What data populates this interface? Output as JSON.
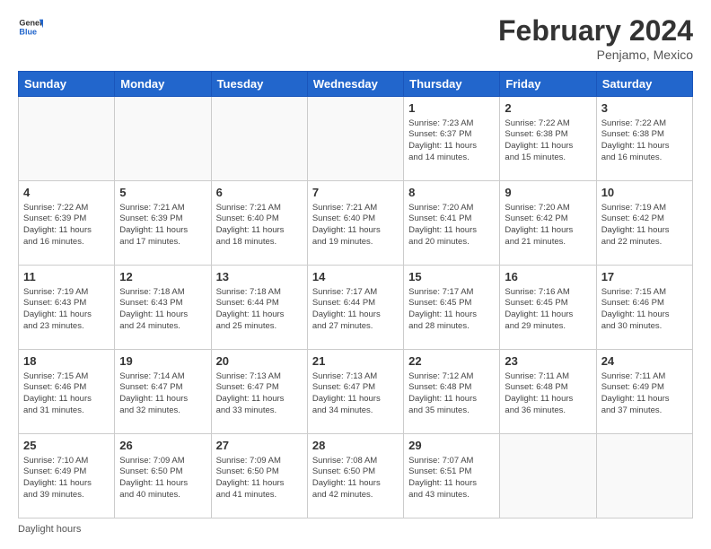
{
  "header": {
    "logo_line1": "General",
    "logo_line2": "Blue",
    "title": "February 2024",
    "subtitle": "Penjamo, Mexico"
  },
  "days_of_week": [
    "Sunday",
    "Monday",
    "Tuesday",
    "Wednesday",
    "Thursday",
    "Friday",
    "Saturday"
  ],
  "weeks": [
    [
      {
        "day": "",
        "info": ""
      },
      {
        "day": "",
        "info": ""
      },
      {
        "day": "",
        "info": ""
      },
      {
        "day": "",
        "info": ""
      },
      {
        "day": "1",
        "info": "Sunrise: 7:23 AM\nSunset: 6:37 PM\nDaylight: 11 hours\nand 14 minutes."
      },
      {
        "day": "2",
        "info": "Sunrise: 7:22 AM\nSunset: 6:38 PM\nDaylight: 11 hours\nand 15 minutes."
      },
      {
        "day": "3",
        "info": "Sunrise: 7:22 AM\nSunset: 6:38 PM\nDaylight: 11 hours\nand 16 minutes."
      }
    ],
    [
      {
        "day": "4",
        "info": "Sunrise: 7:22 AM\nSunset: 6:39 PM\nDaylight: 11 hours\nand 16 minutes."
      },
      {
        "day": "5",
        "info": "Sunrise: 7:21 AM\nSunset: 6:39 PM\nDaylight: 11 hours\nand 17 minutes."
      },
      {
        "day": "6",
        "info": "Sunrise: 7:21 AM\nSunset: 6:40 PM\nDaylight: 11 hours\nand 18 minutes."
      },
      {
        "day": "7",
        "info": "Sunrise: 7:21 AM\nSunset: 6:40 PM\nDaylight: 11 hours\nand 19 minutes."
      },
      {
        "day": "8",
        "info": "Sunrise: 7:20 AM\nSunset: 6:41 PM\nDaylight: 11 hours\nand 20 minutes."
      },
      {
        "day": "9",
        "info": "Sunrise: 7:20 AM\nSunset: 6:42 PM\nDaylight: 11 hours\nand 21 minutes."
      },
      {
        "day": "10",
        "info": "Sunrise: 7:19 AM\nSunset: 6:42 PM\nDaylight: 11 hours\nand 22 minutes."
      }
    ],
    [
      {
        "day": "11",
        "info": "Sunrise: 7:19 AM\nSunset: 6:43 PM\nDaylight: 11 hours\nand 23 minutes."
      },
      {
        "day": "12",
        "info": "Sunrise: 7:18 AM\nSunset: 6:43 PM\nDaylight: 11 hours\nand 24 minutes."
      },
      {
        "day": "13",
        "info": "Sunrise: 7:18 AM\nSunset: 6:44 PM\nDaylight: 11 hours\nand 25 minutes."
      },
      {
        "day": "14",
        "info": "Sunrise: 7:17 AM\nSunset: 6:44 PM\nDaylight: 11 hours\nand 27 minutes."
      },
      {
        "day": "15",
        "info": "Sunrise: 7:17 AM\nSunset: 6:45 PM\nDaylight: 11 hours\nand 28 minutes."
      },
      {
        "day": "16",
        "info": "Sunrise: 7:16 AM\nSunset: 6:45 PM\nDaylight: 11 hours\nand 29 minutes."
      },
      {
        "day": "17",
        "info": "Sunrise: 7:15 AM\nSunset: 6:46 PM\nDaylight: 11 hours\nand 30 minutes."
      }
    ],
    [
      {
        "day": "18",
        "info": "Sunrise: 7:15 AM\nSunset: 6:46 PM\nDaylight: 11 hours\nand 31 minutes."
      },
      {
        "day": "19",
        "info": "Sunrise: 7:14 AM\nSunset: 6:47 PM\nDaylight: 11 hours\nand 32 minutes."
      },
      {
        "day": "20",
        "info": "Sunrise: 7:13 AM\nSunset: 6:47 PM\nDaylight: 11 hours\nand 33 minutes."
      },
      {
        "day": "21",
        "info": "Sunrise: 7:13 AM\nSunset: 6:47 PM\nDaylight: 11 hours\nand 34 minutes."
      },
      {
        "day": "22",
        "info": "Sunrise: 7:12 AM\nSunset: 6:48 PM\nDaylight: 11 hours\nand 35 minutes."
      },
      {
        "day": "23",
        "info": "Sunrise: 7:11 AM\nSunset: 6:48 PM\nDaylight: 11 hours\nand 36 minutes."
      },
      {
        "day": "24",
        "info": "Sunrise: 7:11 AM\nSunset: 6:49 PM\nDaylight: 11 hours\nand 37 minutes."
      }
    ],
    [
      {
        "day": "25",
        "info": "Sunrise: 7:10 AM\nSunset: 6:49 PM\nDaylight: 11 hours\nand 39 minutes."
      },
      {
        "day": "26",
        "info": "Sunrise: 7:09 AM\nSunset: 6:50 PM\nDaylight: 11 hours\nand 40 minutes."
      },
      {
        "day": "27",
        "info": "Sunrise: 7:09 AM\nSunset: 6:50 PM\nDaylight: 11 hours\nand 41 minutes."
      },
      {
        "day": "28",
        "info": "Sunrise: 7:08 AM\nSunset: 6:50 PM\nDaylight: 11 hours\nand 42 minutes."
      },
      {
        "day": "29",
        "info": "Sunrise: 7:07 AM\nSunset: 6:51 PM\nDaylight: 11 hours\nand 43 minutes."
      },
      {
        "day": "",
        "info": ""
      },
      {
        "day": "",
        "info": ""
      }
    ]
  ],
  "footer": {
    "label": "Daylight hours"
  }
}
